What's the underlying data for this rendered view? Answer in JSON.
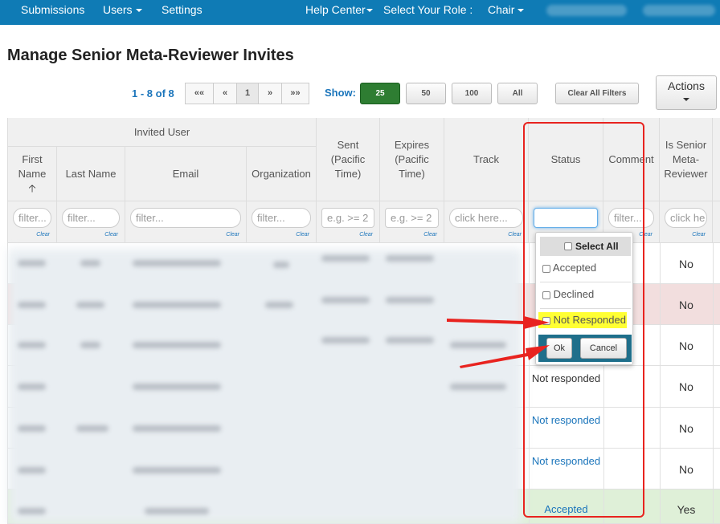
{
  "nav": {
    "submissions": "Submissions",
    "users": "Users",
    "settings": "Settings",
    "help_center": "Help Center",
    "role_label": "Select Your Role :",
    "role_value": "Chair"
  },
  "page_title": "Manage Senior Meta-Reviewer Invites",
  "pagination": {
    "info": "1 - 8 of 8",
    "first": "««",
    "prev": "«",
    "current": "1",
    "next": "»",
    "last": "»»"
  },
  "show": {
    "label": "Show:",
    "sizes": [
      "25",
      "50",
      "100",
      "All"
    ],
    "selected": "25"
  },
  "clear_filters": "Clear All Filters",
  "actions": "Actions",
  "table": {
    "group_header": "Invited User",
    "columns": {
      "first_name": "First Name",
      "last_name": "Last Name",
      "email": "Email",
      "organization": "Organization",
      "sent": "Sent (Pacific Time)",
      "expires": "Expires (Pacific Time)",
      "track": "Track",
      "status": "Status",
      "comment": "Comment",
      "is_senior": "Is Senior Meta-Reviewer"
    },
    "filters": {
      "first_name": "filter...",
      "last_name": "filter...",
      "email": "filter...",
      "organization": "filter...",
      "sent": "e.g. >= 2",
      "expires": "e.g. >= 2",
      "track": "click here...",
      "status": "",
      "comment": "filter...",
      "is_senior": "click he",
      "clear": "Clear"
    },
    "rows": [
      {
        "status": "",
        "is_senior": "No",
        "color": "#ffffff"
      },
      {
        "status": "",
        "is_senior": "No",
        "color": "#f2dede"
      },
      {
        "status": "",
        "is_senior": "No",
        "color": "#ffffff"
      },
      {
        "status": "Not responded",
        "is_senior": "No",
        "color": "#ffffff"
      },
      {
        "status": "Not responded",
        "is_senior": "No",
        "color": "#ffffff"
      },
      {
        "status": "Not responded",
        "is_senior": "No",
        "color": "#ffffff"
      },
      {
        "status": "Accepted",
        "is_senior": "Yes",
        "color": "#dff0d8"
      }
    ]
  },
  "status_dropdown": {
    "select_all": "Select All",
    "options": [
      "Accepted",
      "Declined",
      "Not Responded"
    ],
    "highlighted": "Not Responded",
    "ok": "Ok",
    "cancel": "Cancel"
  },
  "colors": {
    "nav_bg": "#0f7bb5",
    "link": "#1b75bb",
    "annotation_red": "#e8231f",
    "highlight": "#ffff33",
    "active_green": "#2e7d32"
  }
}
